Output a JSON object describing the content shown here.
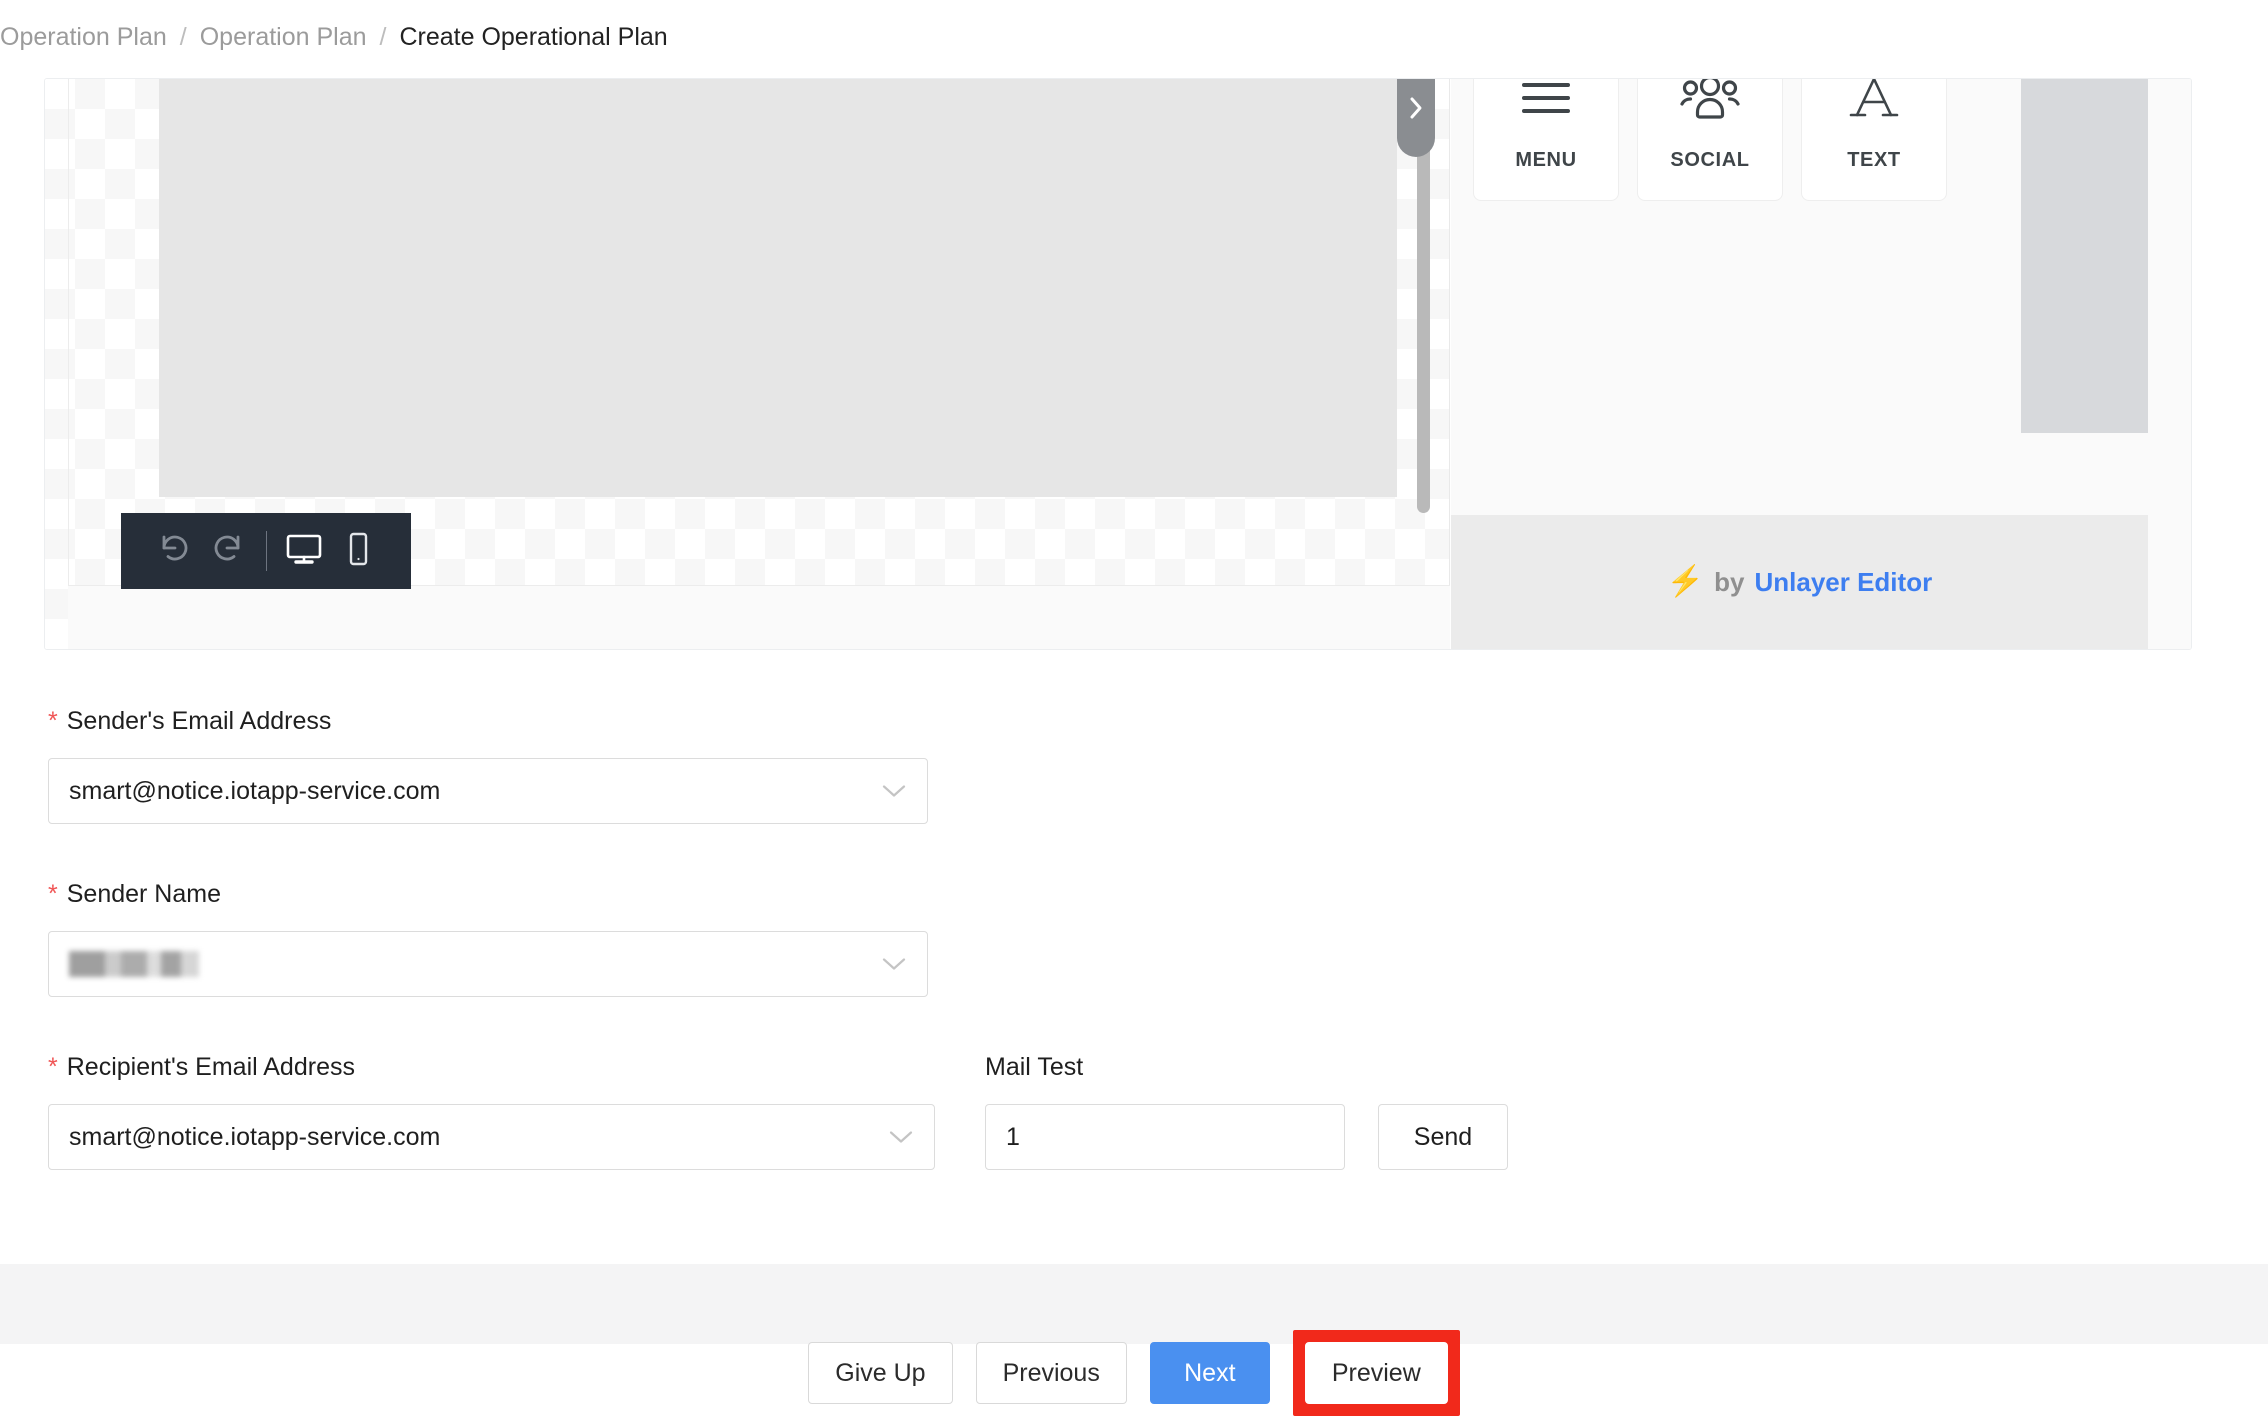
{
  "breadcrumb": {
    "items": [
      {
        "label": "Operation Plan",
        "current": false
      },
      {
        "label": "Operation Plan",
        "current": false
      },
      {
        "label": "Create Operational Plan",
        "current": true
      }
    ],
    "separator": "/"
  },
  "editor": {
    "toolbar": {
      "undo_icon": "undo-icon",
      "redo_icon": "redo-icon",
      "desktop_icon": "desktop-icon",
      "mobile_icon": "mobile-icon"
    },
    "panel_toggle_icon": "chevron-right-icon",
    "blocks": [
      {
        "label": "MENU",
        "icon": "hamburger-menu-icon"
      },
      {
        "label": "SOCIAL",
        "icon": "social-people-icon"
      },
      {
        "label": "TEXT",
        "icon": "text-letter-a-icon"
      }
    ],
    "branding": {
      "bolt_icon": "lightning-bolt-icon",
      "by_text": "by",
      "link_text": "Unlayer Editor"
    }
  },
  "form": {
    "sender_email": {
      "label": "Sender's Email Address",
      "required_mark": "*",
      "value": "smart@notice.iotapp-service.com",
      "chevron_icon": "chevron-down-icon"
    },
    "sender_name": {
      "label": "Sender Name",
      "required_mark": "*",
      "value": "",
      "chevron_icon": "chevron-down-icon"
    },
    "recipient_email": {
      "label": "Recipient's Email Address",
      "required_mark": "*",
      "value": "smart@notice.iotapp-service.com",
      "chevron_icon": "chevron-down-icon"
    },
    "mail_test": {
      "label": "Mail Test",
      "value": "1",
      "send_label": "Send"
    }
  },
  "footer": {
    "give_up_label": "Give Up",
    "previous_label": "Previous",
    "next_label": "Next",
    "preview_label": "Preview"
  },
  "colors": {
    "primary_blue": "#4a90f0",
    "highlight_red": "#f1291b",
    "required_red": "#f05656",
    "unlayer_blue": "#3d7ef0",
    "bolt_orange": "#f5a623"
  }
}
